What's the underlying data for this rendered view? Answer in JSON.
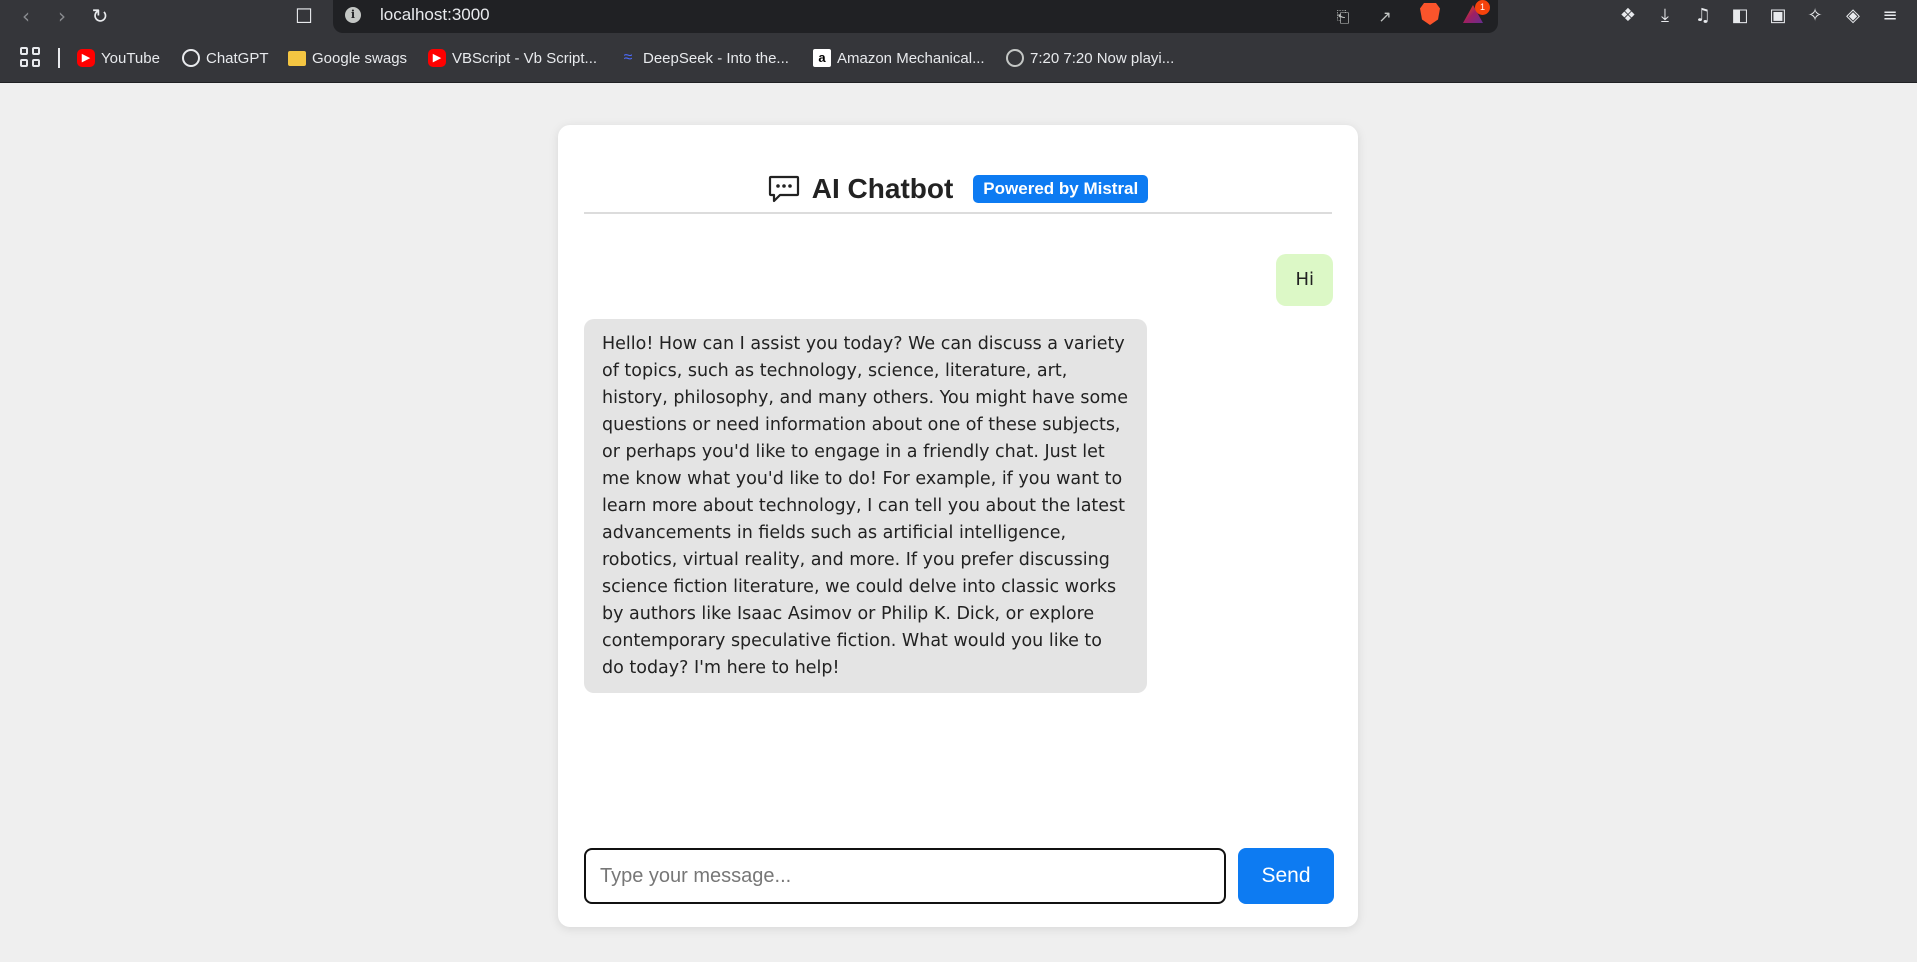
{
  "browser": {
    "url": "localhost:3000",
    "bat_badge_count": "1",
    "bookmarks": [
      {
        "label": "YouTube",
        "icon": "youtube-icon"
      },
      {
        "label": "ChatGPT",
        "icon": "chatgpt-icon"
      },
      {
        "label": "Google swags",
        "icon": "folder-icon"
      },
      {
        "label": "VBScript - Vb Script...",
        "icon": "youtube-icon"
      },
      {
        "label": "DeepSeek - Into the...",
        "icon": "deepseek-icon"
      },
      {
        "label": "Amazon Mechanical...",
        "icon": "amazon-icon"
      },
      {
        "label": "7:20 7:20 Now playi...",
        "icon": "globe-icon"
      }
    ]
  },
  "chat": {
    "title": "AI Chatbot",
    "badge": "Powered by Mistral",
    "messages": [
      {
        "role": "user",
        "text": "Hi"
      },
      {
        "role": "bot",
        "text": "Hello! How can I assist you today? We can discuss a variety of topics, such as technology, science, literature, art, history, philosophy, and many others. You might have some questions or need information about one of these subjects, or perhaps you'd like to engage in a friendly chat. Just let me know what you'd like to do! For example, if you want to learn more about technology, I can tell you about the latest advancements in fields such as artificial intelligence, robotics, virtual reality, and more. If you prefer discussing science fiction literature, we could delve into classic works by authors like Isaac Asimov or Philip K. Dick, or explore contemporary speculative fiction. What would you like to do today? I'm here to help!"
      }
    ],
    "input_placeholder": "Type your message...",
    "input_value": "",
    "send_label": "Send"
  },
  "colors": {
    "accent": "#0d7bf2",
    "user_bubble": "#dcf8c6",
    "bot_bubble": "#e4e4e4",
    "page_bg": "#efefef"
  }
}
